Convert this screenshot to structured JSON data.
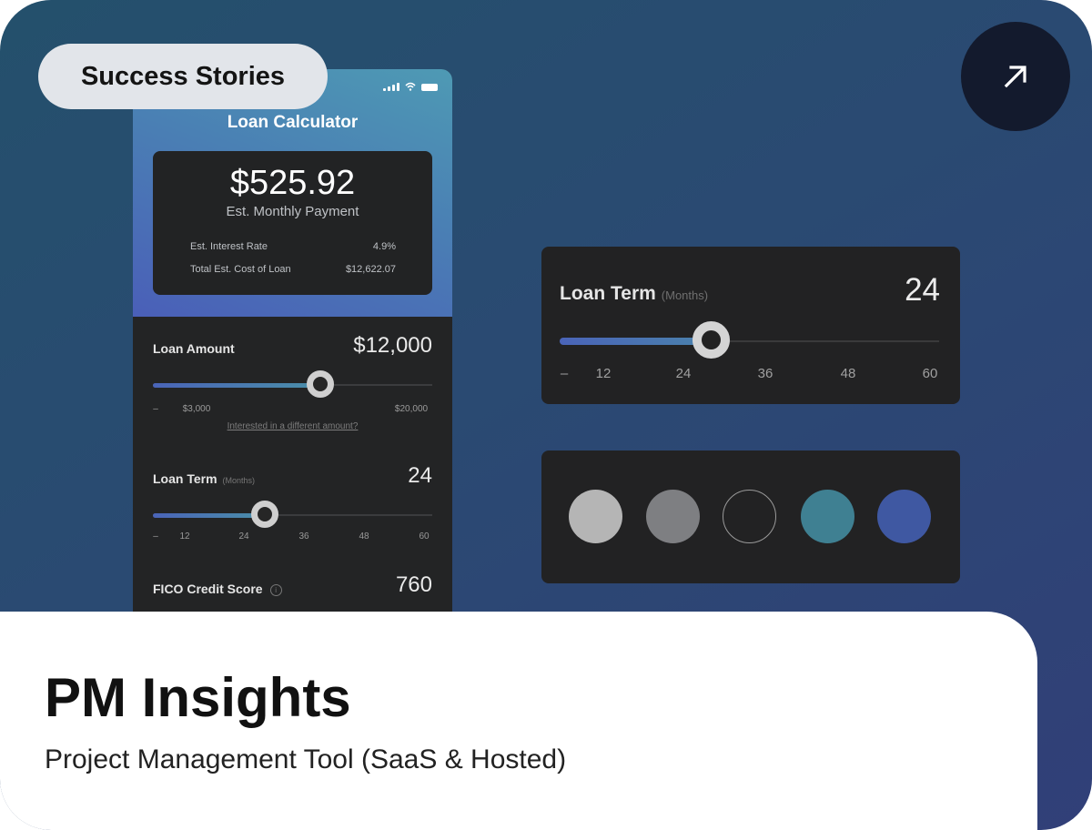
{
  "badge": {
    "label": "Success Stories"
  },
  "phone": {
    "title": "Loan Calculator",
    "payment": {
      "amount": "$525.92",
      "label": "Est. Monthly Payment",
      "rows": [
        {
          "label": "Est. Interest Rate",
          "value": "4.9%"
        },
        {
          "label": "Total Est. Cost of Loan",
          "value": "$12,622.07"
        }
      ]
    },
    "loan_amount": {
      "label": "Loan Amount",
      "value": "$12,000",
      "ticks": [
        "–",
        "$3,000",
        "$20,000"
      ],
      "link": "Interested in a different amount?",
      "level": 0.6
    },
    "loan_term": {
      "label": "Loan Term",
      "sub": "(Months)",
      "value": "24",
      "ticks": [
        "–",
        "12",
        "24",
        "36",
        "48",
        "60"
      ],
      "level": 0.4
    },
    "fico": {
      "label": "FICO Credit Score",
      "info": "i",
      "value": "760"
    }
  },
  "term_card": {
    "label": "Loan Term",
    "sub": "(Months)",
    "value": "24",
    "ticks": [
      "–",
      "12",
      "24",
      "36",
      "48",
      "60"
    ],
    "level": 0.4
  },
  "swatches": [
    "#b5b5b5",
    "#7e7f82",
    "#222223",
    "#3f8092",
    "#3f58a2"
  ],
  "footer": {
    "title": "PM Insights",
    "subtitle": "Project Management Tool (SaaS & Hosted)"
  },
  "arrow_icon": "arrow-up-right-icon"
}
